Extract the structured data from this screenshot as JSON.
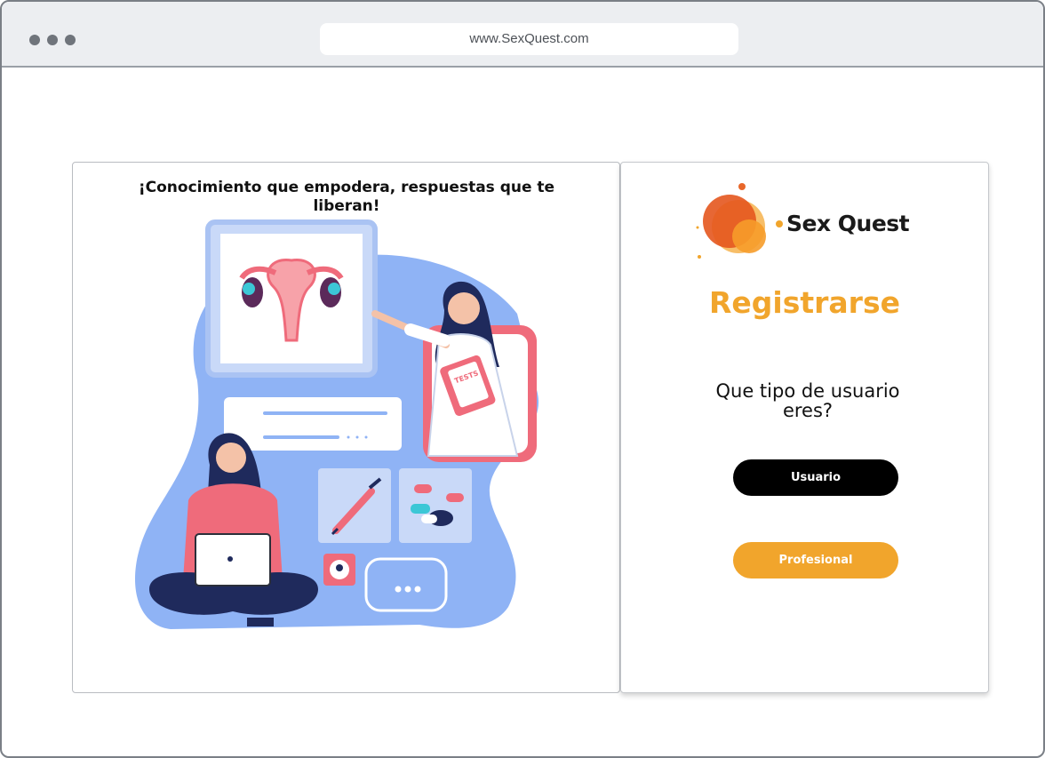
{
  "browser": {
    "url": "www.SexQuest.com",
    "dots": [
      "window-dot-1",
      "window-dot-2",
      "window-dot-3"
    ]
  },
  "hero": {
    "tagline": "¡Conocimiento que empodera, respuestas que te liberan!",
    "illustration_label": "TESTS"
  },
  "auth": {
    "logo_text": "Sex Quest",
    "title": "Registrarse",
    "question": "Que tipo de usuario eres?",
    "buttons": {
      "user_label": "Usuario",
      "professional_label": "Profesional"
    }
  },
  "colors": {
    "accent": "#f1a52c",
    "dark_button": "#000000",
    "illustration_blue": "#8fb3f5",
    "illustration_pink": "#ef6b7b"
  }
}
